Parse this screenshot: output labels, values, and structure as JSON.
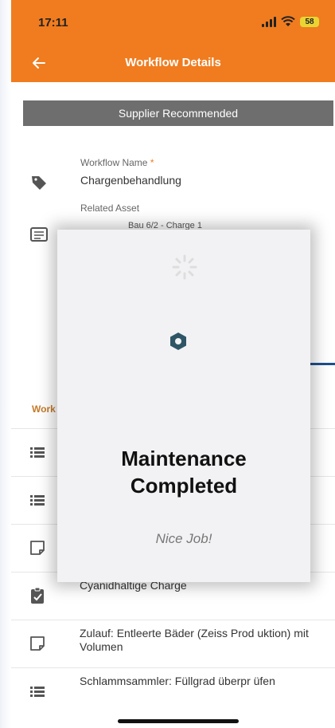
{
  "status_bar": {
    "time": "17:11",
    "battery": "58"
  },
  "nav": {
    "title": "Workflow Details",
    "back_icon": "back-arrow-icon"
  },
  "banner": {
    "label": "Supplier Recommended"
  },
  "form": {
    "workflow_name_label": "Workflow Name",
    "required_marker": "*",
    "workflow_name_value": "Chargenbehandlung",
    "related_asset_label": "Related Asset",
    "related_asset_value": "Bau 6/2 - Charge 1"
  },
  "section": {
    "label": "Work"
  },
  "list_items": [
    {
      "text": "",
      "icon": "list-icon"
    },
    {
      "text": "",
      "icon": "list-icon"
    },
    {
      "text": "",
      "icon": "note-icon"
    },
    {
      "text": "Cyanidhaltige Charge",
      "icon": "clipboard-check-icon"
    },
    {
      "text": "Zulauf: Entleerte Bäder (Zeiss Prod uktion) mit Volumen",
      "icon": "note-icon"
    },
    {
      "text": "Schlammsammler: Füllgrad überpr üfen",
      "icon": "list-icon"
    }
  ],
  "modal": {
    "title": "Maintenance\nCompleted",
    "subtitle": "Nice Job!"
  },
  "colors": {
    "brand": "#f07c1f",
    "banner": "#6e6e6e",
    "logo": "#2e5566"
  }
}
